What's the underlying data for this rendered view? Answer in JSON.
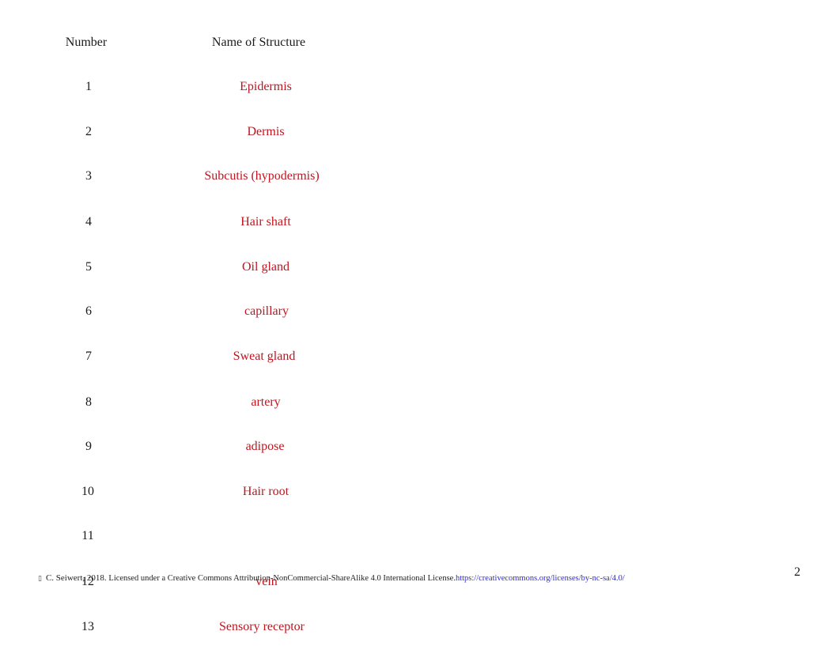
{
  "table": {
    "headers": {
      "number": "Number",
      "name": "Name of Structure"
    },
    "rows": [
      {
        "number": "1",
        "name": "Epidermis"
      },
      {
        "number": "2",
        "name": "Dermis"
      },
      {
        "number": "3",
        "name": "Subcutis (hypodermis)"
      },
      {
        "number": "4",
        "name": "Hair shaft"
      },
      {
        "number": "5",
        "name": "Oil gland"
      },
      {
        "number": "6",
        "name": "capillary"
      },
      {
        "number": "7",
        "name": "Sweat gland"
      },
      {
        "number": "8",
        "name": "artery"
      },
      {
        "number": "9",
        "name": "adipose"
      },
      {
        "number": "10",
        "name": "Hair root"
      },
      {
        "number": "11",
        "name": ""
      },
      {
        "number": "12",
        "name": "vein"
      },
      {
        "number": "13",
        "name": "Sensory receptor"
      }
    ]
  },
  "footer": {
    "icon": "license-icon",
    "author": "C. Seiwert, 2018.",
    "license_text": "Licensed under a Creative Commons Attribution-NonCommercial-ShareAlike 4.0 International License.",
    "license_url": "https://creativecommons.org/licenses/by-nc-sa/4.0/"
  },
  "page_number": "2",
  "colors": {
    "answer_text": "#c0141e",
    "link": "#2b2bd8"
  }
}
